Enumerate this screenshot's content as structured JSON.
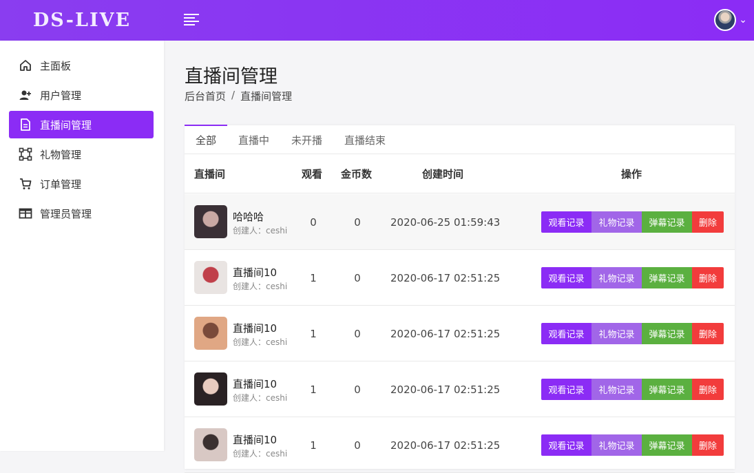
{
  "app": {
    "logo": "DS-LIVE"
  },
  "sidebar": {
    "items": [
      {
        "label": "主面板",
        "icon": "home-icon"
      },
      {
        "label": "用户管理",
        "icon": "user-add-icon"
      },
      {
        "label": "直播间管理",
        "icon": "document-icon",
        "active": true
      },
      {
        "label": "礼物管理",
        "icon": "shape-icon"
      },
      {
        "label": "订单管理",
        "icon": "cart-icon"
      },
      {
        "label": "管理员管理",
        "icon": "table-icon"
      }
    ]
  },
  "page": {
    "title": "直播间管理",
    "breadcrumb": {
      "home": "后台首页",
      "sep": "/",
      "current": "直播间管理"
    }
  },
  "tabs": [
    "全部",
    "直播中",
    "未开播",
    "直播结束"
  ],
  "table": {
    "headers": {
      "room": "直播间",
      "views": "观看",
      "coins": "金币数",
      "created": "创建时间",
      "ops": "操作"
    },
    "actions": {
      "watch": "观看记录",
      "gift": "礼物记录",
      "danmu": "弹幕记录",
      "delete": "删除"
    },
    "rows": [
      {
        "name": "哈哈哈",
        "creator": "创建人：ceshi",
        "views": "0",
        "coins": "0",
        "created": "2020-06-25 01:59:43",
        "colors": [
          "#3a3036",
          "#c9a9a4"
        ]
      },
      {
        "name": "直播间10",
        "creator": "创建人：ceshi",
        "views": "1",
        "coins": "0",
        "created": "2020-06-17 02:51:25",
        "colors": [
          "#e9e4e2",
          "#c0404a"
        ]
      },
      {
        "name": "直播间10",
        "creator": "创建人：ceshi",
        "views": "1",
        "coins": "0",
        "created": "2020-06-17 02:51:25",
        "colors": [
          "#e0a784",
          "#7a4a3a"
        ]
      },
      {
        "name": "直播间10",
        "creator": "创建人：ceshi",
        "views": "1",
        "coins": "0",
        "created": "2020-06-17 02:51:25",
        "colors": [
          "#2a2224",
          "#e8cbbf"
        ]
      },
      {
        "name": "直播间10",
        "creator": "创建人：ceshi",
        "views": "1",
        "coins": "0",
        "created": "2020-06-17 02:51:25",
        "colors": [
          "#d8c8c4",
          "#3a3030"
        ]
      }
    ]
  }
}
